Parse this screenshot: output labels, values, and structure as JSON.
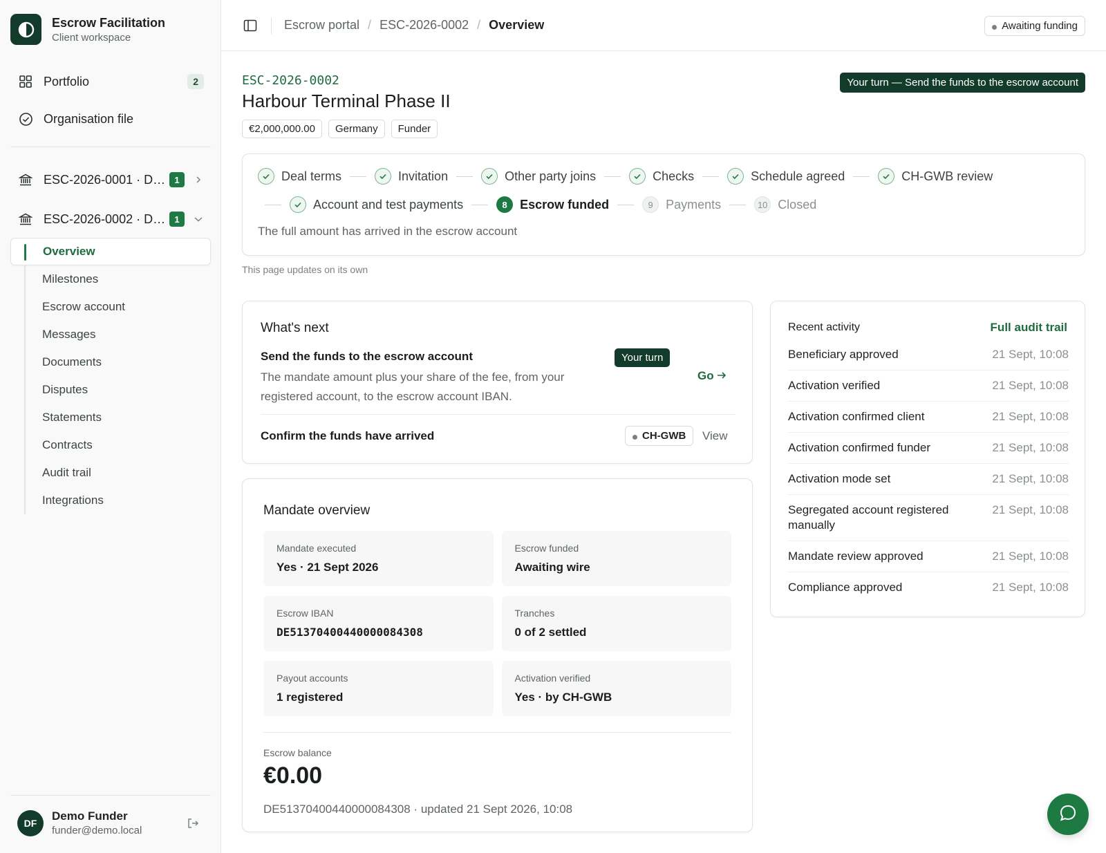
{
  "colors": {
    "brand_dark": "#123b2b",
    "accent_green": "#1e7a43",
    "link_green": "#1e6b40"
  },
  "brand": {
    "title": "Escrow Facilitation",
    "subtitle": "Client workspace",
    "logo_icon": "brand-logo-icon"
  },
  "sidebar": {
    "nav": [
      {
        "label": "Portfolio",
        "icon": "grid-icon",
        "count": "2"
      },
      {
        "label": "Organisation file",
        "icon": "check-circle-icon"
      }
    ],
    "deals": [
      {
        "label": "ESC-2026-0001 · D…",
        "badge": "1",
        "icon": "bank-icon",
        "expanded": false
      },
      {
        "label": "ESC-2026-0002 · D…",
        "badge": "1",
        "icon": "bank-icon",
        "expanded": true
      }
    ],
    "subnav": [
      {
        "label": "Overview",
        "active": true
      },
      {
        "label": "Milestones"
      },
      {
        "label": "Escrow account"
      },
      {
        "label": "Messages"
      },
      {
        "label": "Documents"
      },
      {
        "label": "Disputes"
      },
      {
        "label": "Statements"
      },
      {
        "label": "Contracts"
      },
      {
        "label": "Audit trail"
      },
      {
        "label": "Integrations"
      }
    ],
    "user": {
      "initials": "DF",
      "name": "Demo Funder",
      "email": "funder@demo.local"
    }
  },
  "topbar": {
    "breadcrumbs": [
      "Escrow portal",
      "ESC-2026-0002",
      "Overview"
    ],
    "status": "Awaiting funding"
  },
  "deal": {
    "code": "ESC-2026-0002",
    "title": "Harbour Terminal Phase II",
    "tags": [
      "€2,000,000.00",
      "Germany",
      "Funder"
    ],
    "turn_banner": "Your turn — Send the funds to the escrow account"
  },
  "stepper": {
    "row1": [
      {
        "label": "Deal terms",
        "state": "done"
      },
      {
        "label": "Invitation",
        "state": "done"
      },
      {
        "label": "Other party joins",
        "state": "done"
      },
      {
        "label": "Checks",
        "state": "done"
      },
      {
        "label": "Schedule agreed",
        "state": "done"
      },
      {
        "label": "CH-GWB review",
        "state": "done"
      }
    ],
    "row2": [
      {
        "label": "Account and test payments",
        "state": "done"
      },
      {
        "label": "Escrow funded",
        "state": "current",
        "number": "8"
      },
      {
        "label": "Payments",
        "state": "todo",
        "number": "9"
      },
      {
        "label": "Closed",
        "state": "todo",
        "number": "10"
      }
    ],
    "description": "The full amount has arrived in the escrow account",
    "updates_note": "This page updates on its own"
  },
  "whats_next": {
    "title": "What's next",
    "task_title": "Send the funds to the escrow account",
    "task_desc": "The mandate amount plus your share of the fee, from your registered account, to the escrow account IBAN.",
    "your_turn": "Your turn",
    "go_label": "Go",
    "confirm_title": "Confirm the funds have arrived",
    "party": "CH-GWB",
    "view_label": "View"
  },
  "mandate": {
    "title": "Mandate overview",
    "cells": [
      {
        "label": "Mandate executed",
        "value": "Yes · 21 Sept 2026"
      },
      {
        "label": "Escrow funded",
        "value": "Awaiting wire"
      },
      {
        "label": "Escrow IBAN",
        "value": "DE51370400440000084308",
        "mono": true
      },
      {
        "label": "Tranches",
        "value": "0 of 2 settled"
      },
      {
        "label": "Payout accounts",
        "value": "1 registered"
      },
      {
        "label": "Activation verified",
        "value": "Yes · by CH-GWB"
      }
    ],
    "balance_label": "Escrow balance",
    "balance_value": "€0.00",
    "balance_meta": "DE51370400440000084308 · updated 21 Sept 2026, 10:08"
  },
  "activity": {
    "title": "Recent activity",
    "audit_link": "Full audit trail",
    "items": [
      {
        "name": "Beneficiary approved",
        "time": "21 Sept, 10:08"
      },
      {
        "name": "Activation verified",
        "time": "21 Sept, 10:08"
      },
      {
        "name": "Activation confirmed client",
        "time": "21 Sept, 10:08"
      },
      {
        "name": "Activation confirmed funder",
        "time": "21 Sept, 10:08"
      },
      {
        "name": "Activation mode set",
        "time": "21 Sept, 10:08"
      },
      {
        "name": "Segregated account registered manually",
        "time": "21 Sept, 10:08"
      },
      {
        "name": "Mandate review approved",
        "time": "21 Sept, 10:08"
      },
      {
        "name": "Compliance approved",
        "time": "21 Sept, 10:08"
      }
    ]
  }
}
